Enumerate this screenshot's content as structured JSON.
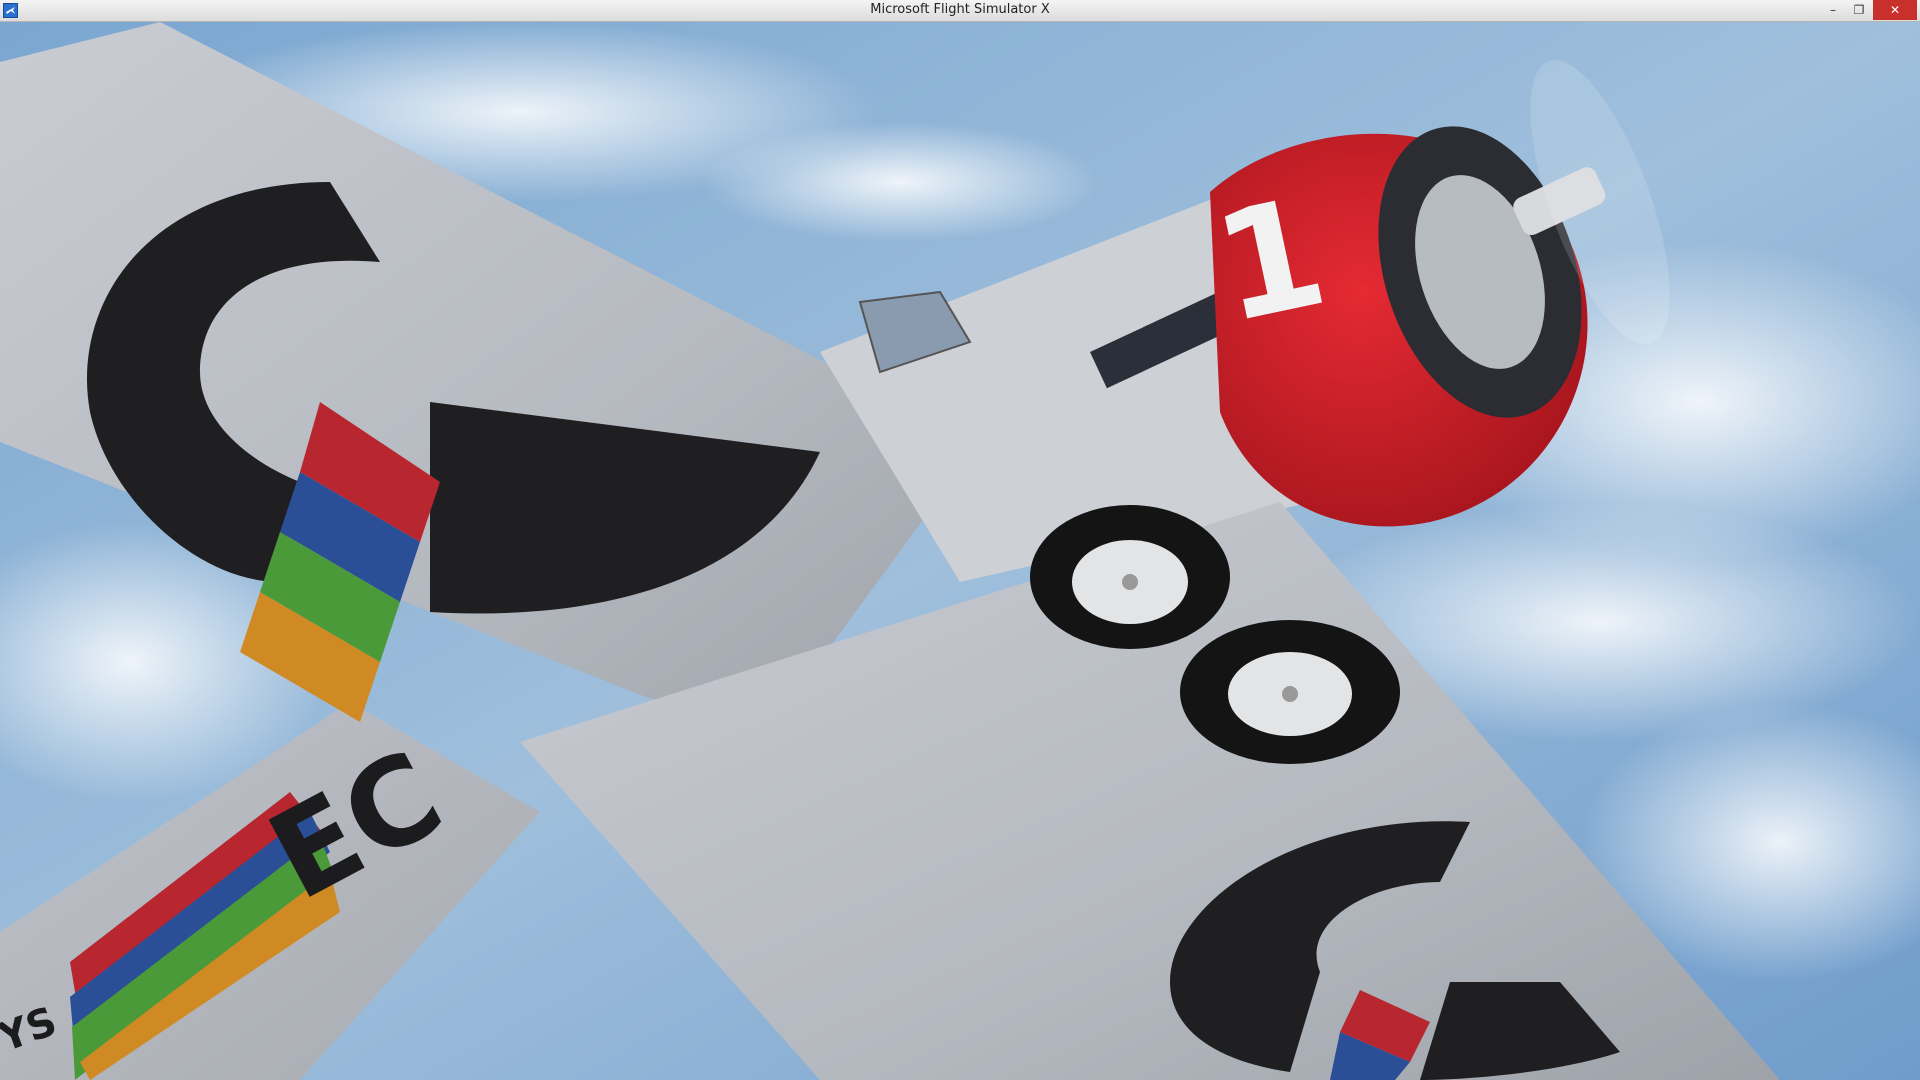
{
  "window": {
    "title": "Microsoft Flight Simulator X",
    "minimize_icon": "minimize-icon",
    "maximize_icon": "restore-icon",
    "close_icon": "close-icon"
  },
  "scene": {
    "cowling_number": "1",
    "wing_registration_fragment": "EC",
    "wing_tip_fragment": "YS"
  }
}
